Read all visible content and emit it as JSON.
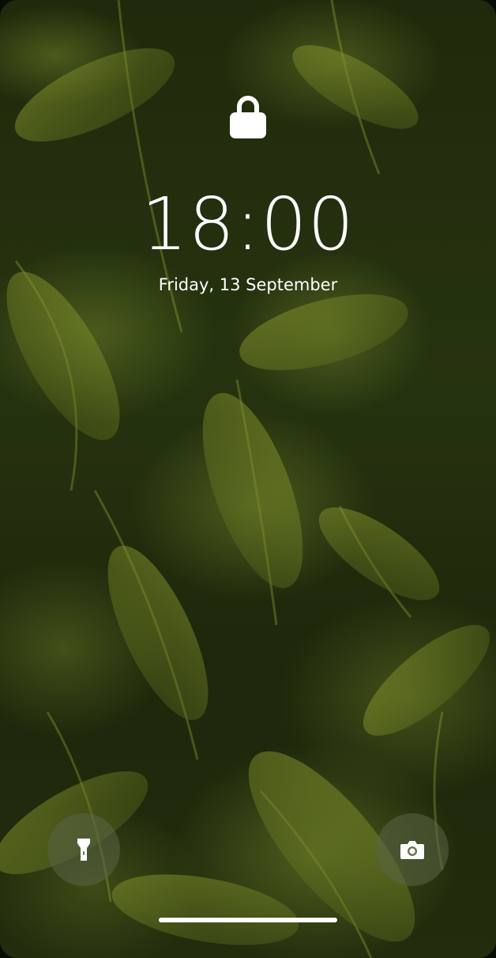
{
  "lockscreen": {
    "time": "18:00",
    "date": "Friday, 13 September"
  },
  "icons": {
    "lock": "lock-icon",
    "flashlight": "flashlight-icon",
    "camera": "camera-icon"
  },
  "colors": {
    "text": "#ffffff",
    "button_bg": "rgba(90,100,70,0.55)",
    "home_indicator": "#ffffff"
  }
}
